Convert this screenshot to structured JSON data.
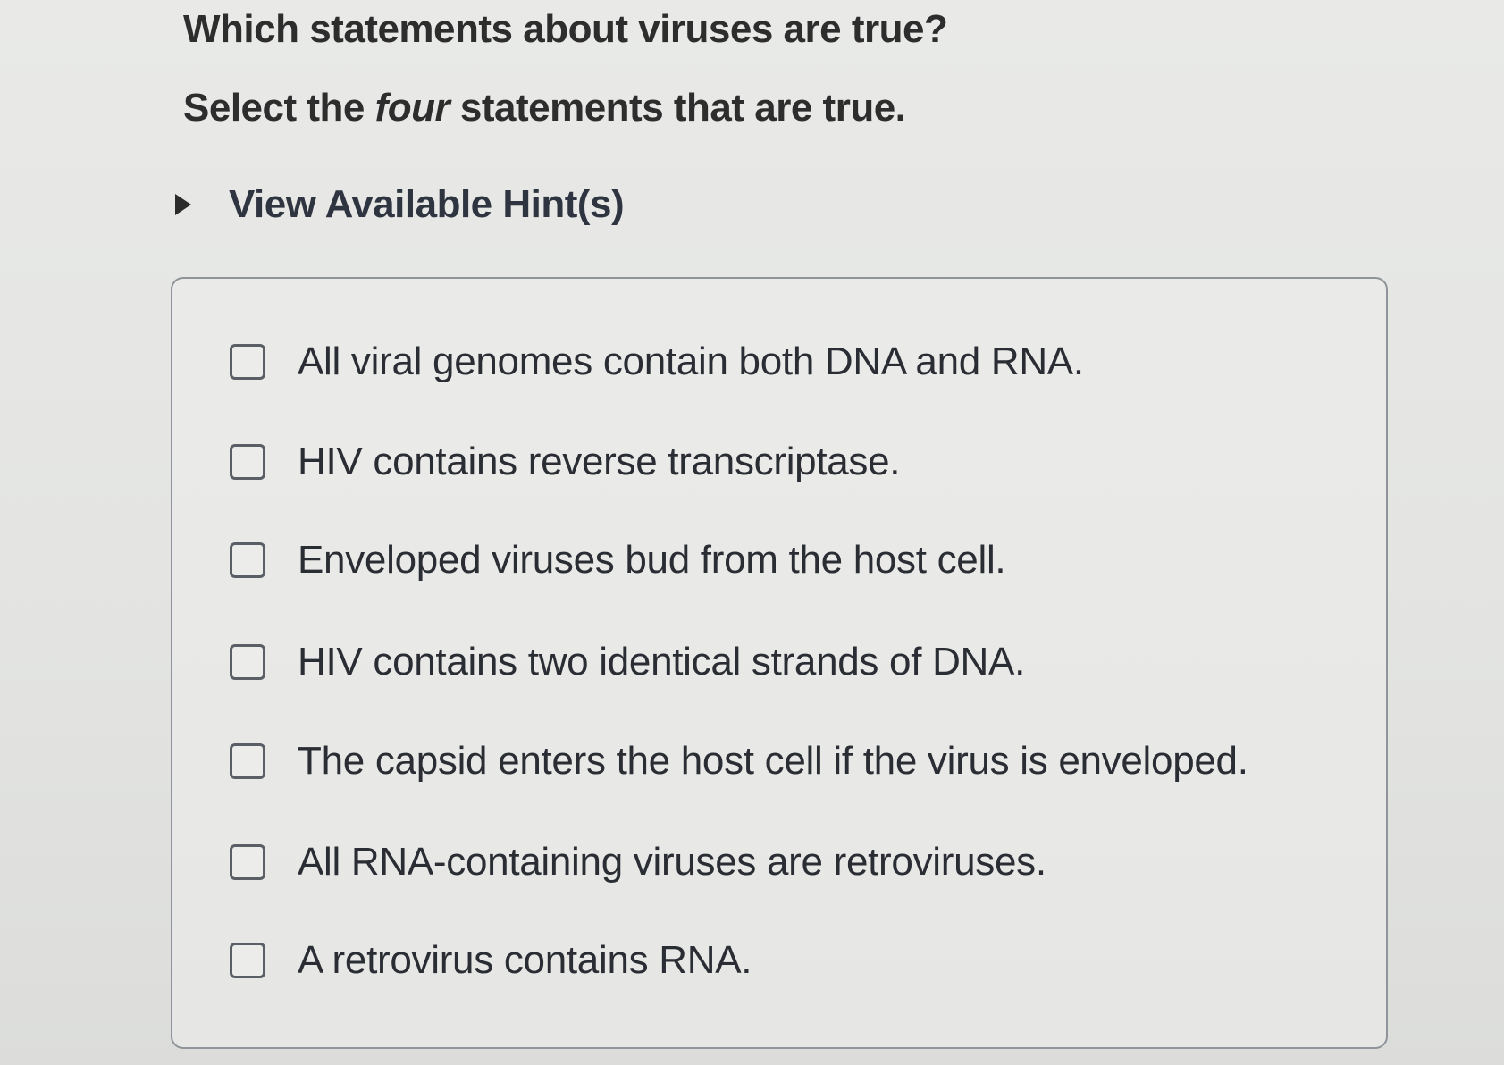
{
  "question": {
    "title": "Which statements about viruses are true?",
    "instruction_before": "Select the ",
    "instruction_emphasis": "four",
    "instruction_after": " statements that are true."
  },
  "hint": {
    "label": "View Available Hint(s)",
    "icon": "caret-right-icon"
  },
  "options": [
    {
      "label": "All viral genomes contain both DNA and RNA.",
      "checked": false
    },
    {
      "label": "HIV contains reverse transcriptase.",
      "checked": false
    },
    {
      "label": "Enveloped viruses bud from the host cell.",
      "checked": false
    },
    {
      "label": "HIV contains two identical strands of DNA.",
      "checked": false
    },
    {
      "label": "The capsid enters the host cell if the virus is enveloped.",
      "checked": false
    },
    {
      "label": "All RNA-containing viruses are retroviruses.",
      "checked": false
    },
    {
      "label": "A retrovirus contains RNA.",
      "checked": false
    }
  ]
}
